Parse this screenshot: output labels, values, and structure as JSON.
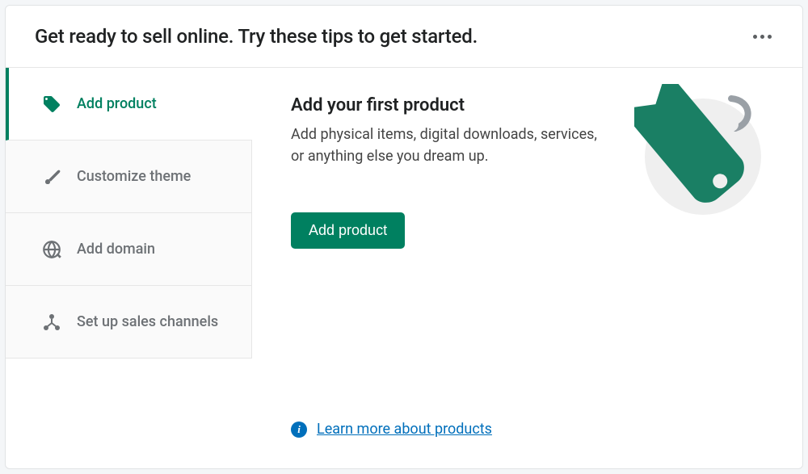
{
  "header": {
    "title": "Get ready to sell online. Try these tips to get started."
  },
  "sidebar": {
    "items": [
      {
        "label": "Add product",
        "active": true
      },
      {
        "label": "Customize theme",
        "active": false
      },
      {
        "label": "Add domain",
        "active": false
      },
      {
        "label": "Set up sales channels",
        "active": false
      }
    ]
  },
  "content": {
    "title": "Add your first product",
    "description": "Add physical items, digital downloads, services, or anything else you dream up.",
    "primary_button": "Add product",
    "learn_more": "Learn more about products"
  },
  "colors": {
    "primary": "#008060",
    "link": "#006fbb"
  }
}
